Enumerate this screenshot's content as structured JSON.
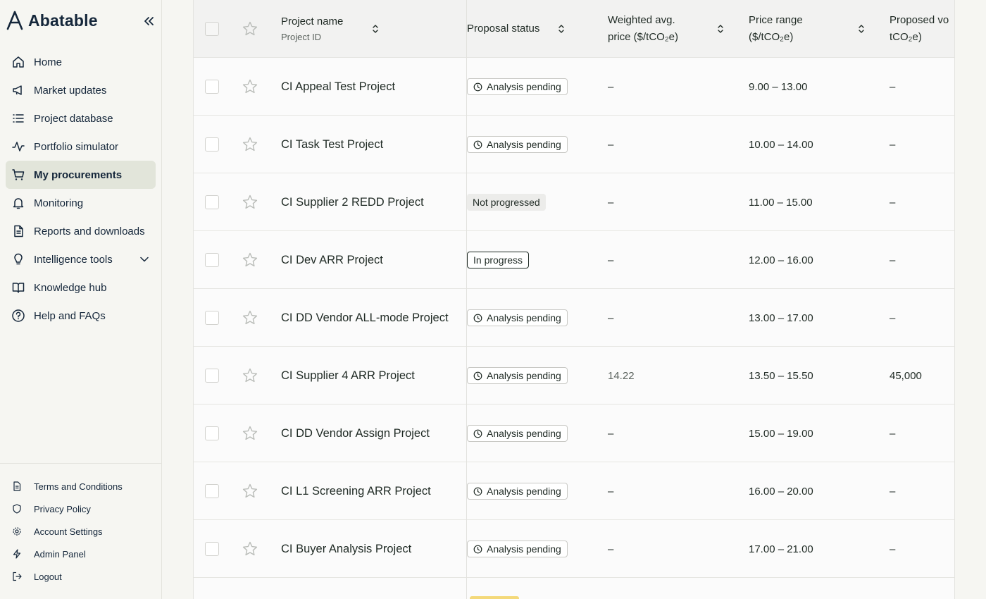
{
  "brand": {
    "name": "Abatable"
  },
  "nav": [
    {
      "label": "Home",
      "icon": "home-icon",
      "active": false
    },
    {
      "label": "Market updates",
      "icon": "megaphone-icon",
      "active": false
    },
    {
      "label": "Project database",
      "icon": "list-icon",
      "active": false
    },
    {
      "label": "Portfolio simulator",
      "icon": "activity-icon",
      "active": false
    },
    {
      "label": "My procurements",
      "icon": "cart-icon",
      "active": true
    },
    {
      "label": "Monitoring",
      "icon": "bell-icon",
      "active": false
    },
    {
      "label": "Reports and downloads",
      "icon": "document-icon",
      "active": false
    },
    {
      "label": "Intelligence tools",
      "icon": "lightbulb-icon",
      "active": false,
      "expandable": true
    },
    {
      "label": "Knowledge hub",
      "icon": "book-icon",
      "active": false
    },
    {
      "label": "Help and FAQs",
      "icon": "help-circle-icon",
      "active": false
    }
  ],
  "footer_nav": [
    {
      "label": "Terms and Conditions",
      "icon": "document-icon"
    },
    {
      "label": "Privacy Policy",
      "icon": "shield-icon"
    },
    {
      "label": "Account Settings",
      "icon": "gear-icon"
    },
    {
      "label": "Admin Panel",
      "icon": "lightning-icon"
    },
    {
      "label": "Logout",
      "icon": "logout-icon"
    }
  ],
  "table": {
    "headers": {
      "project_name": "Project name",
      "project_id": "Project ID",
      "proposal_status": "Proposal status",
      "weighted_price_line1": "Weighted avg.",
      "weighted_price_line2": "price ($/tCO₂e)",
      "price_range_line1": "Price range",
      "price_range_line2": "($/tCO₂e)",
      "proposed_volume_line1": "Proposed vo",
      "proposed_volume_line2": "tCO₂e)"
    },
    "rows": [
      {
        "name": "CI Appeal Test Project",
        "status": "Analysis pending",
        "status_type": "pending",
        "weighted_price": "–",
        "price_range": "9.00 – 13.00",
        "proposed_volume": "–"
      },
      {
        "name": "CI Task Test Project",
        "status": "Analysis pending",
        "status_type": "pending",
        "weighted_price": "–",
        "price_range": "10.00 – 14.00",
        "proposed_volume": "–"
      },
      {
        "name": "CI Supplier 2 REDD Project",
        "status": "Not progressed",
        "status_type": "notprog",
        "weighted_price": "–",
        "price_range": "11.00 – 15.00",
        "proposed_volume": "–"
      },
      {
        "name": "CI Dev ARR Project",
        "status": "In progress",
        "status_type": "inprog",
        "weighted_price": "–",
        "price_range": "12.00 – 16.00",
        "proposed_volume": "–"
      },
      {
        "name": "CI DD Vendor ALL-mode Project",
        "status": "Analysis pending",
        "status_type": "pending",
        "weighted_price": "–",
        "price_range": "13.00 – 17.00",
        "proposed_volume": "–"
      },
      {
        "name": "CI Supplier 4 ARR Project",
        "status": "Analysis pending",
        "status_type": "pending",
        "weighted_price": "14.22",
        "price_range": "13.50 – 15.50",
        "proposed_volume": "45,000"
      },
      {
        "name": "CI DD Vendor Assign Project",
        "status": "Analysis pending",
        "status_type": "pending",
        "weighted_price": "–",
        "price_range": "15.00 – 19.00",
        "proposed_volume": "–"
      },
      {
        "name": "CI L1 Screening ARR Project",
        "status": "Analysis pending",
        "status_type": "pending",
        "weighted_price": "–",
        "price_range": "16.00 – 20.00",
        "proposed_volume": "–"
      },
      {
        "name": "CI Buyer Analysis Project",
        "status": "Analysis pending",
        "status_type": "pending",
        "weighted_price": "–",
        "price_range": "17.00 – 21.00",
        "proposed_volume": "–"
      }
    ]
  },
  "colors": {
    "brand_navy": "#14263a",
    "active_nav_bg": "#e2e5da",
    "page_bg": "#f6f6f2"
  }
}
